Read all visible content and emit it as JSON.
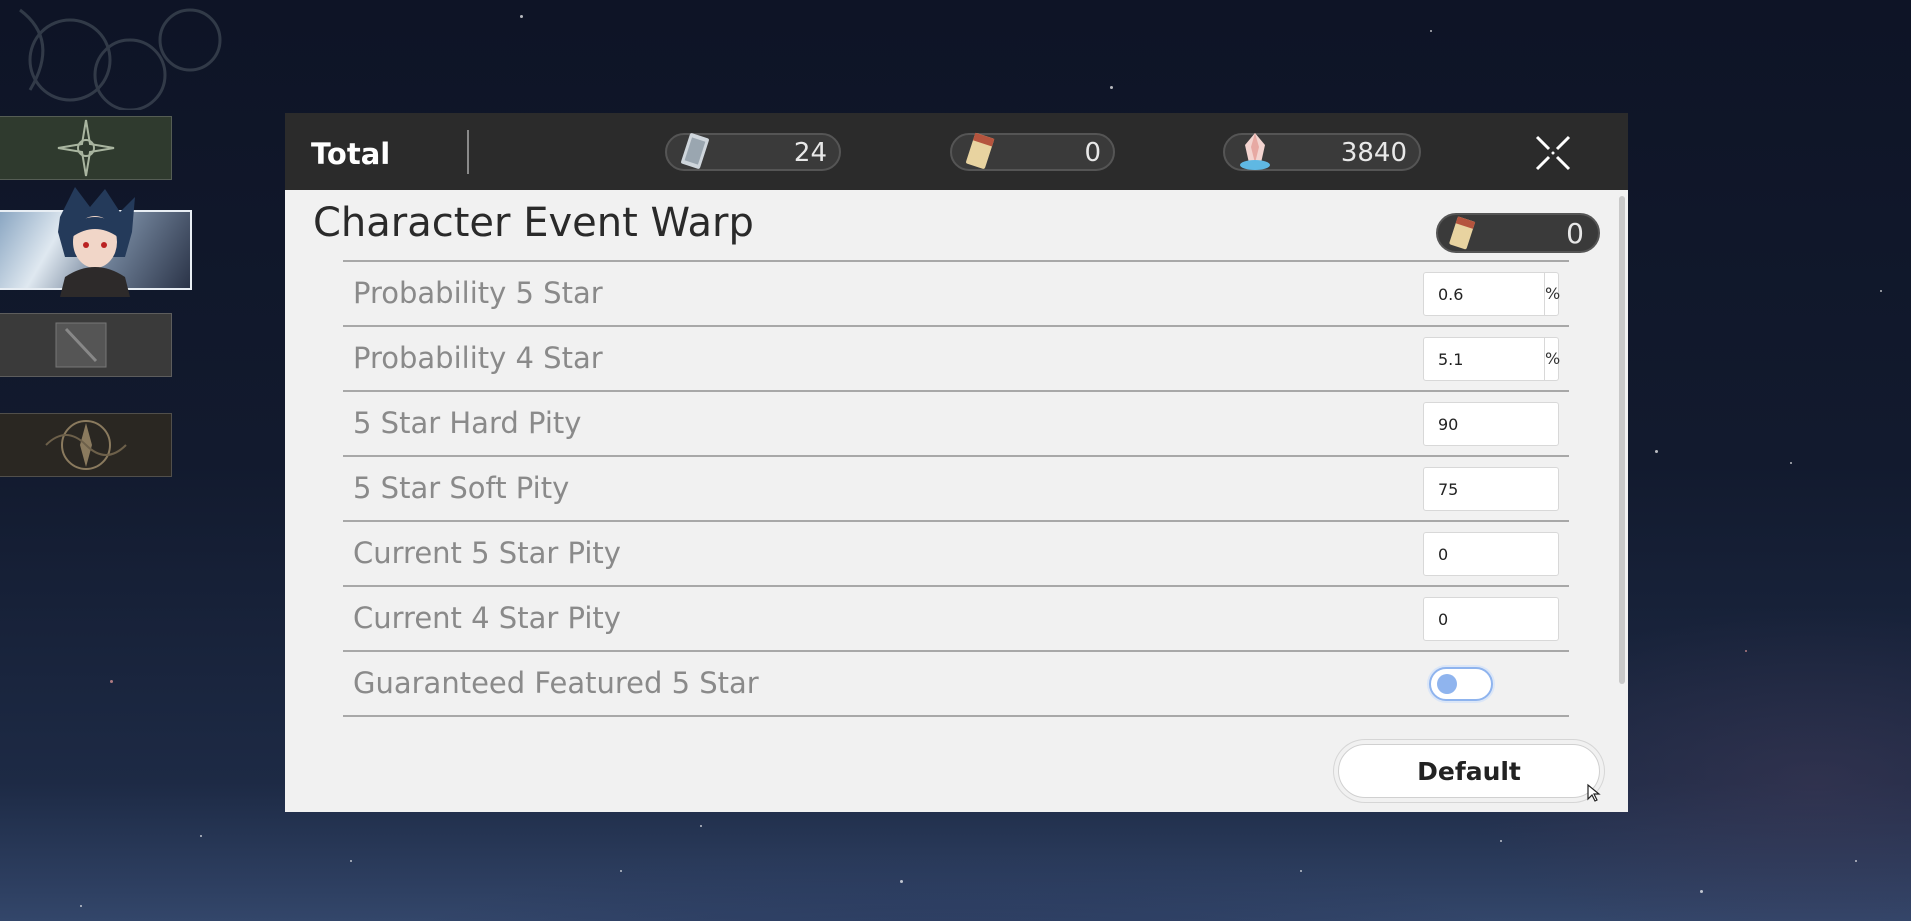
{
  "header": {
    "title": "Total",
    "currencies": [
      {
        "icon": "special-pass-icon",
        "value": "24"
      },
      {
        "icon": "star-rail-pass-icon",
        "value": "0"
      },
      {
        "icon": "stellar-jade-icon",
        "value": "3840"
      }
    ]
  },
  "section": {
    "title": "Character Event Warp",
    "pass_count": "0"
  },
  "settings": [
    {
      "label": "Probability 5 Star",
      "value": "0.6",
      "unit": "%"
    },
    {
      "label": "Probability 4 Star",
      "value": "5.1",
      "unit": "%"
    },
    {
      "label": "5 Star Hard Pity",
      "value": "90"
    },
    {
      "label": "5 Star Soft Pity",
      "value": "75"
    },
    {
      "label": "Current 5 Star Pity",
      "value": "0"
    },
    {
      "label": "Current 4 Star Pity",
      "value": "0"
    },
    {
      "label": "Guaranteed Featured 5 Star",
      "toggle": false
    }
  ],
  "default_button": "Default",
  "colors": {
    "header_bg": "#2b2b2b",
    "panel_bg": "#f1f1f1",
    "toggle_accent": "#8fb4ee"
  }
}
